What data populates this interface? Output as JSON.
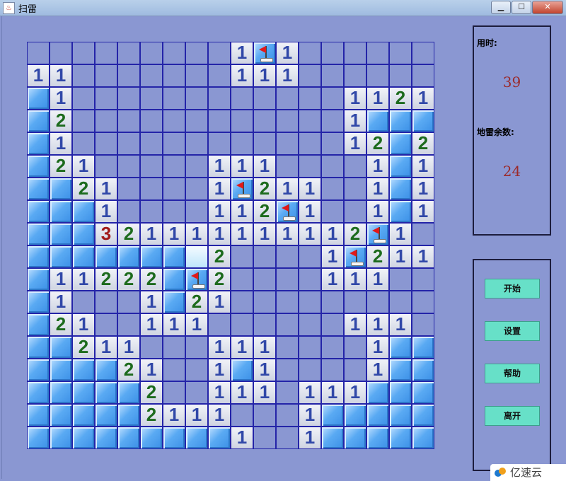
{
  "window": {
    "title": "扫雷",
    "app_icon_glyph": "♨",
    "minimize_glyph": "▁",
    "maximize_glyph": "☐",
    "close_glyph": "✕"
  },
  "board": {
    "legend": "h = hidden, space = revealed empty, digit = number, F = flag, L = highlighted",
    "rows": [
      "         1F1      ",
      "11       111      ",
      "h1            1121",
      "h2            1hhh",
      "h1            12h2",
      "h21     111    1h1",
      "hh21    1F211  1h1",
      "hhh1    112F1  1h1",
      "hhh321111111112F1",
      "hhhhhhhL2    1F211",
      "h11222hF2    111  ",
      "h1   1h21         ",
      "h21  111      111 ",
      "hh211   111    1hh",
      "hhhh21  1h1    1hh",
      "hhhhh2  111 111hhh",
      "hhhhh2111   1hhhhh",
      "hhhhhhhhh1  1hhhhh"
    ]
  },
  "info": {
    "time_label": "用时:",
    "time_value": "39",
    "mines_label": "地雷余数:",
    "mines_value": "24"
  },
  "buttons": {
    "start": "开始",
    "settings": "设置",
    "help": "帮助",
    "exit": "离开"
  },
  "watermark": {
    "text": "亿速云"
  },
  "colors": {
    "background": "#8a97d2",
    "grid_line": "#1f1fa3",
    "hidden_cell": "#4a9ef0",
    "number_1": "#3148a8",
    "number_2": "#1d6b1d",
    "number_3": "#a11a1a",
    "flag": "#e11919",
    "button": "#67e0c8"
  }
}
